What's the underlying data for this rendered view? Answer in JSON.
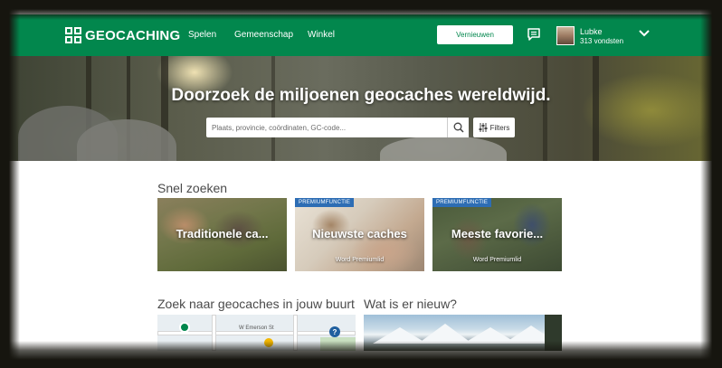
{
  "header": {
    "logo_text": "GEOCACHING",
    "nav": [
      "Spelen",
      "Gemeenschap",
      "Winkel"
    ],
    "upgrade_label": "Vernieuwen",
    "user": {
      "name": "Lubke",
      "finds": "313 vondsten"
    },
    "brand_color": "#02874d"
  },
  "hero": {
    "title": "Doorzoek de miljoenen geocaches wereldwijd.",
    "search_placeholder": "Plaats, provincie, coördinaten, GC-code...",
    "filters_label": "Filters"
  },
  "quick_search": {
    "title": "Snel zoeken",
    "cards": [
      {
        "title": "Traditionele ca...",
        "badge": "",
        "subtitle": ""
      },
      {
        "title": "Nieuwste caches",
        "badge": "PREMIUMFUNCTIE",
        "subtitle": "Word Premiumlid"
      },
      {
        "title": "Meeste favorie...",
        "badge": "PREMIUMFUNCTIE",
        "subtitle": "Word Premiumlid"
      }
    ],
    "badge_color": "#2d6db4"
  },
  "nearby": {
    "title": "Zoek naar geocaches in jouw buurt",
    "street_label": "W Emerson St"
  },
  "news": {
    "title": "Wat is er nieuw?"
  },
  "icons": [
    "logo-icon",
    "chat-icon",
    "chevron-down-icon",
    "search-icon",
    "filters-icon",
    "map-pin-icon",
    "help-icon"
  ]
}
